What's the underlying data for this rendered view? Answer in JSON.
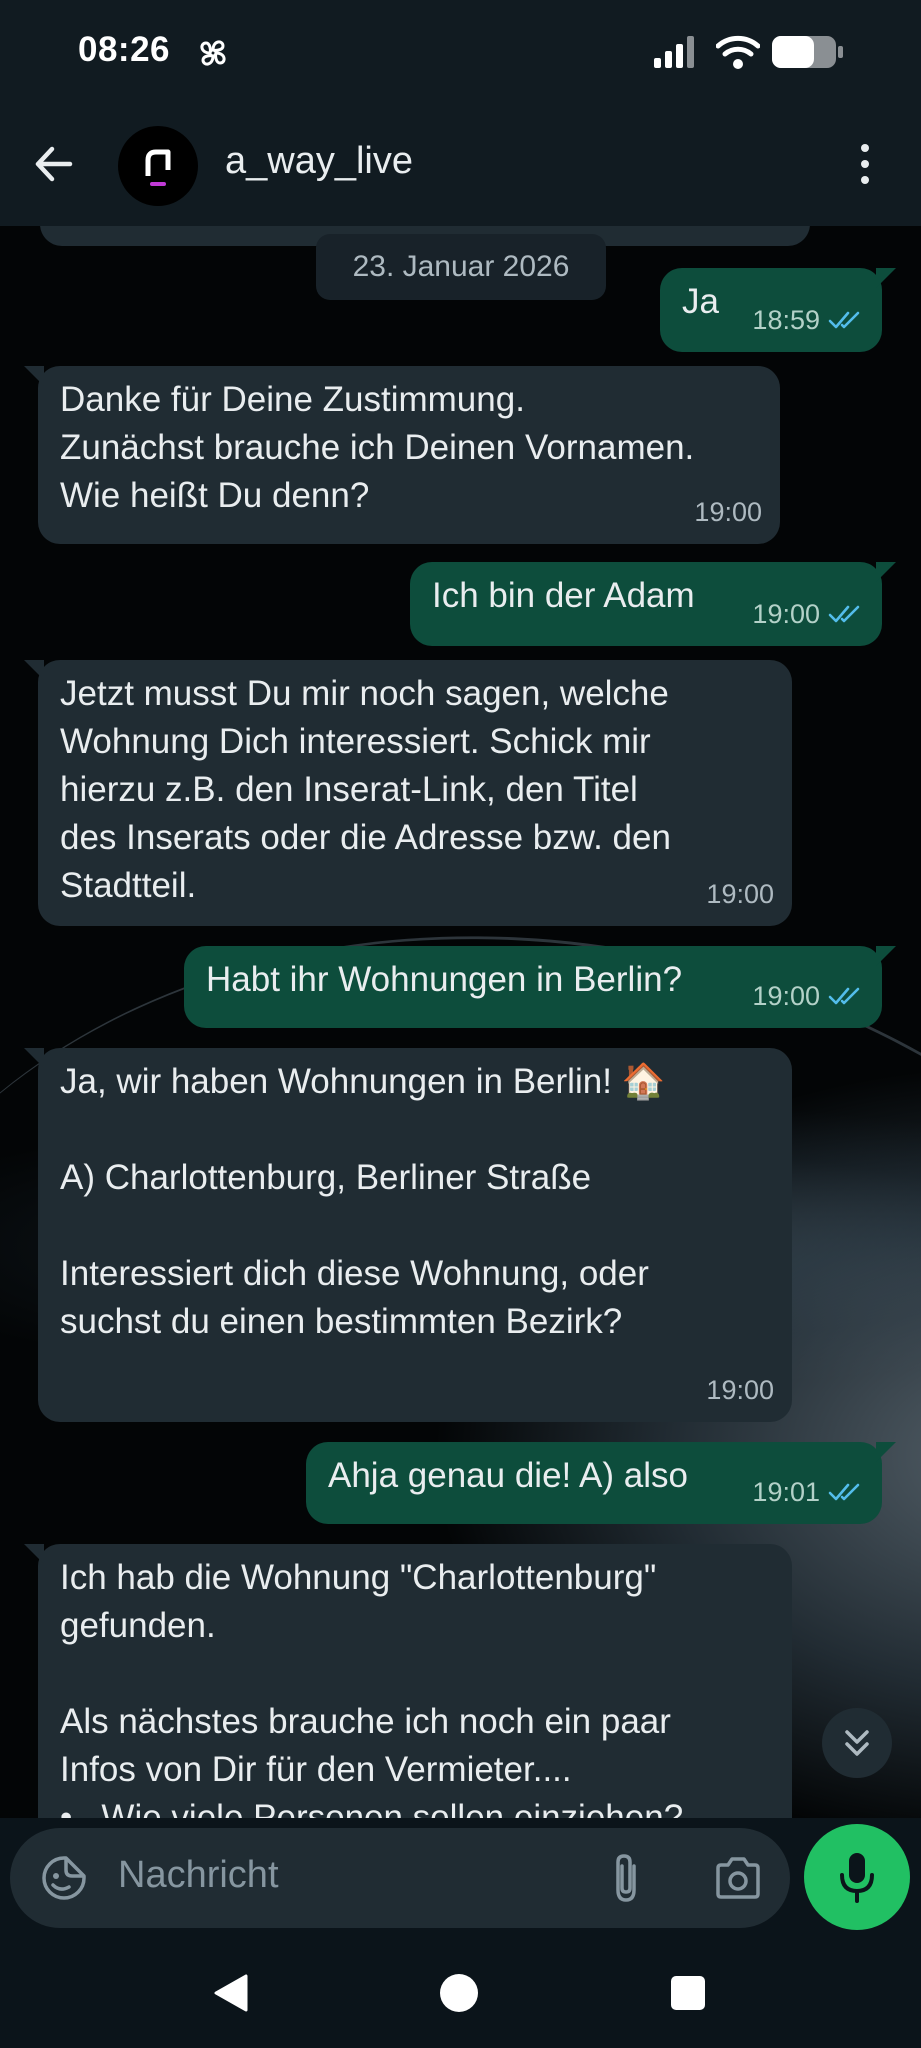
{
  "status_bar": {
    "time": "08:26"
  },
  "header": {
    "contact_name": "a_way_live"
  },
  "chat": {
    "date_chip": "23. Januar 2026",
    "messages": [
      {
        "direction": "out",
        "text": "Ja",
        "time": "18:59"
      },
      {
        "direction": "in",
        "text": "Danke für Deine Zustimmung.\nZunächst brauche ich Deinen Vornamen.\nWie heißt Du denn?",
        "time": "19:00"
      },
      {
        "direction": "out",
        "text": "Ich bin der Adam",
        "time": "19:00"
      },
      {
        "direction": "in",
        "text": "Jetzt musst Du mir noch sagen, welche\nWohnung Dich interessiert. Schick mir\nhierzu z.B. den Inserat-Link, den Titel\ndes Inserats oder die Adresse bzw. den\nStadtteil.",
        "time": "19:00"
      },
      {
        "direction": "out",
        "text": "Habt ihr Wohnungen in Berlin?",
        "time": "19:00"
      },
      {
        "direction": "in",
        "text": "Ja, wir haben Wohnungen in Berlin! 🏠\n\nA) Charlottenburg, Berliner Straße\n\nInteressiert dich diese Wohnung, oder\nsuchst du einen bestimmten Bezirk?",
        "time": "19:00"
      },
      {
        "direction": "out",
        "text": "Ahja genau die! A) also",
        "time": "19:01"
      },
      {
        "direction": "in",
        "text": "Ich hab die Wohnung \"Charlottenburg\"\ngefunden.\n\nAls nächstes brauche ich noch ein paar\nInfos von Dir für den Vermieter....\n•   Wie viele Personen sollen einziehen?",
        "time": ""
      }
    ]
  },
  "input": {
    "placeholder": "Nachricht"
  },
  "colors": {
    "accent": "#21c063",
    "outgoing_bubble": "#0d4d3c",
    "incoming_bubble": "#202c33",
    "read_ticks": "#53bdeb"
  }
}
